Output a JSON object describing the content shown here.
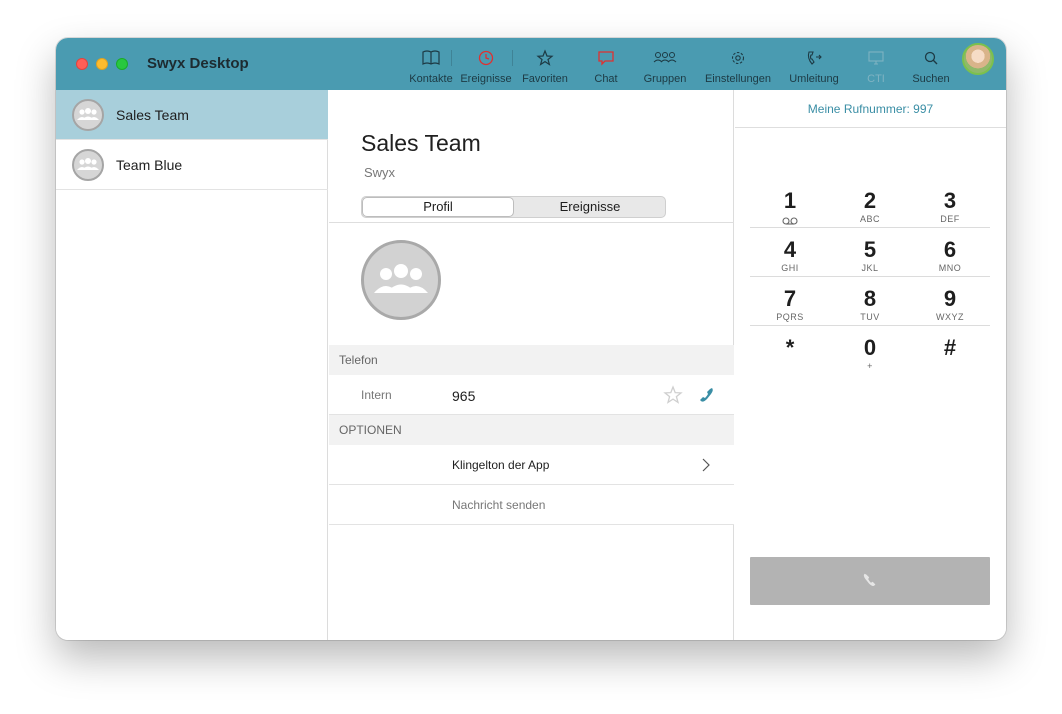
{
  "window": {
    "title": "Swyx Desktop"
  },
  "toolbar": {
    "items": [
      {
        "label": "Kontakte",
        "icon": "book-icon"
      },
      {
        "label": "Ereignisse",
        "icon": "clock-icon"
      },
      {
        "label": "Favoriten",
        "icon": "star-icon"
      },
      {
        "label": "Chat",
        "icon": "chat-bubble-icon"
      },
      {
        "label": "Gruppen",
        "icon": "group-icon"
      },
      {
        "label": "Einstellungen",
        "icon": "gear-icon"
      },
      {
        "label": "Umleitung",
        "icon": "call-forward-icon"
      },
      {
        "label": "CTI",
        "icon": "monitor-icon",
        "state": "disabled"
      },
      {
        "label": "Suchen",
        "icon": "search-icon"
      }
    ],
    "accent_red": "#e03030"
  },
  "sidebar": {
    "items": [
      {
        "name": "Sales Team",
        "selected": true
      },
      {
        "name": "Team Blue",
        "selected": false
      }
    ]
  },
  "detail": {
    "title": "Sales Team",
    "subtitle": "Swyx",
    "tabs": [
      {
        "label": "Profil",
        "active": true
      },
      {
        "label": "Ereignisse",
        "active": false
      }
    ],
    "phone_section": "Telefon",
    "phone_rows": [
      {
        "type": "Intern",
        "number": "965"
      }
    ],
    "options_section": "OPTIONEN",
    "options": [
      {
        "label": "Klingelton der App"
      },
      {
        "label": "Nachricht senden"
      }
    ]
  },
  "dialpad": {
    "my_number": "Meine Rufnummer: 997",
    "keys": [
      {
        "digit": "1",
        "letters": ""
      },
      {
        "digit": "2",
        "letters": "ABC"
      },
      {
        "digit": "3",
        "letters": "DEF"
      },
      {
        "digit": "4",
        "letters": "GHI"
      },
      {
        "digit": "5",
        "letters": "JKL"
      },
      {
        "digit": "6",
        "letters": "MNO"
      },
      {
        "digit": "7",
        "letters": "PQRS"
      },
      {
        "digit": "8",
        "letters": "TUV"
      },
      {
        "digit": "9",
        "letters": "WXYZ"
      },
      {
        "digit": "*",
        "letters": ""
      },
      {
        "digit": "0",
        "letters": "+"
      },
      {
        "digit": "#",
        "letters": ""
      }
    ]
  },
  "colors": {
    "titlebar": "#4a9bb1",
    "selection": "#a8cfdb",
    "link": "#3a8ea5"
  }
}
